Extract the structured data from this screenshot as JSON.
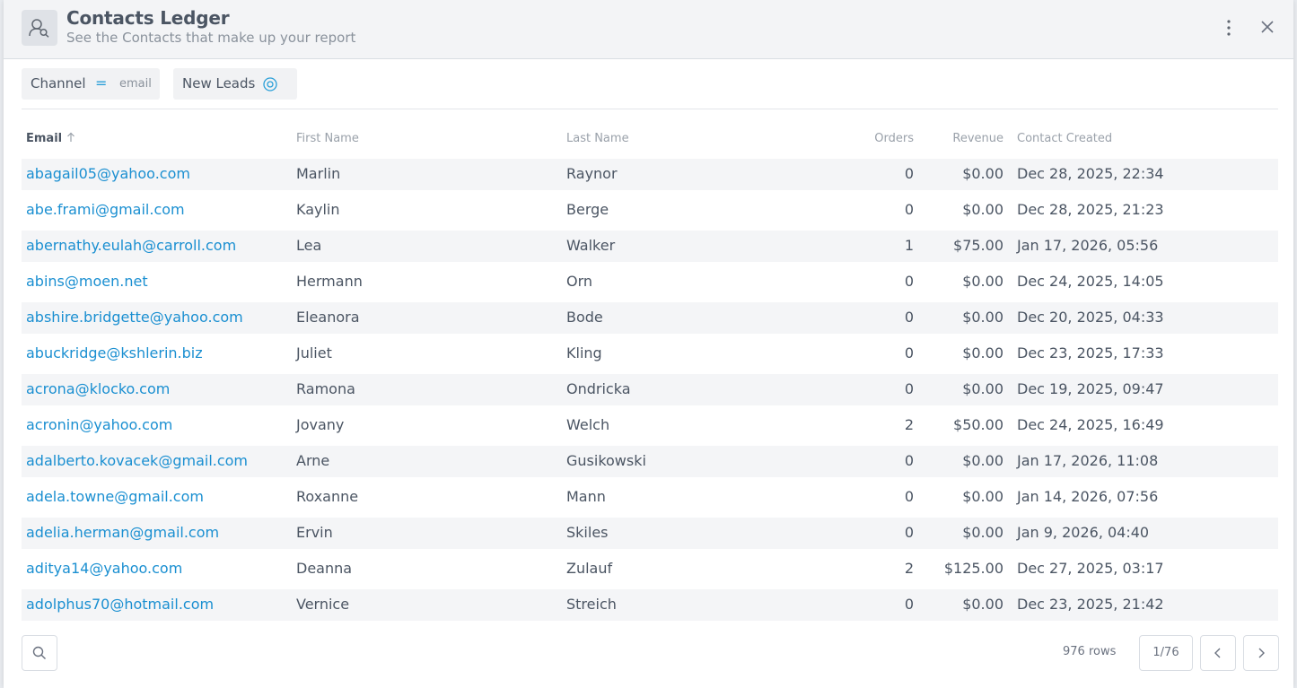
{
  "header": {
    "title": "Contacts Ledger",
    "subtitle": "See the Contacts that make up your report",
    "icon": "contacts-search-icon"
  },
  "filters": [
    {
      "label": "Channel",
      "operator": "=",
      "value": "email"
    },
    {
      "label": "New Leads",
      "icon": "target-icon"
    }
  ],
  "table": {
    "columns": [
      "Email",
      "First Name",
      "Last Name",
      "Orders",
      "Revenue",
      "Contact Created"
    ],
    "sorted_column": "Email",
    "sort_direction": "ascending",
    "rows": [
      [
        "abagail05@yahoo.com",
        "Marlin",
        "Raynor",
        "0",
        "$0.00",
        "Dec 28, 2025, 22:34"
      ],
      [
        "abe.frami@gmail.com",
        "Kaylin",
        "Berge",
        "0",
        "$0.00",
        "Dec 28, 2025, 21:23"
      ],
      [
        "abernathy.eulah@carroll.com",
        "Lea",
        "Walker",
        "1",
        "$75.00",
        "Jan 17, 2026, 05:56"
      ],
      [
        "abins@moen.net",
        "Hermann",
        "Orn",
        "0",
        "$0.00",
        "Dec 24, 2025, 14:05"
      ],
      [
        "abshire.bridgette@yahoo.com",
        "Eleanora",
        "Bode",
        "0",
        "$0.00",
        "Dec 20, 2025, 04:33"
      ],
      [
        "abuckridge@kshlerin.biz",
        "Juliet",
        "Kling",
        "0",
        "$0.00",
        "Dec 23, 2025, 17:33"
      ],
      [
        "acrona@klocko.com",
        "Ramona",
        "Ondricka",
        "0",
        "$0.00",
        "Dec 19, 2025, 09:47"
      ],
      [
        "acronin@yahoo.com",
        "Jovany",
        "Welch",
        "2",
        "$50.00",
        "Dec 24, 2025, 16:49"
      ],
      [
        "adalberto.kovacek@gmail.com",
        "Arne",
        "Gusikowski",
        "0",
        "$0.00",
        "Jan 17, 2026, 11:08"
      ],
      [
        "adela.towne@gmail.com",
        "Roxanne",
        "Mann",
        "0",
        "$0.00",
        "Jan 14, 2026, 07:56"
      ],
      [
        "adelia.herman@gmail.com",
        "Ervin",
        "Skiles",
        "0",
        "$0.00",
        "Jan 9, 2026, 04:40"
      ],
      [
        "aditya14@yahoo.com",
        "Deanna",
        "Zulauf",
        "2",
        "$125.00",
        "Dec 27, 2025, 03:17"
      ],
      [
        "adolphus70@hotmail.com",
        "Vernice",
        "Streich",
        "0",
        "$0.00",
        "Dec 23, 2025, 21:42"
      ]
    ]
  },
  "footer": {
    "rows_count": "976 rows",
    "page": "1/76"
  },
  "colors": {
    "link": "#1a8fd1",
    "accent": "#2a9fd8",
    "header_bg": "#f3f4f6",
    "row_alt": "#f4f5f7"
  }
}
